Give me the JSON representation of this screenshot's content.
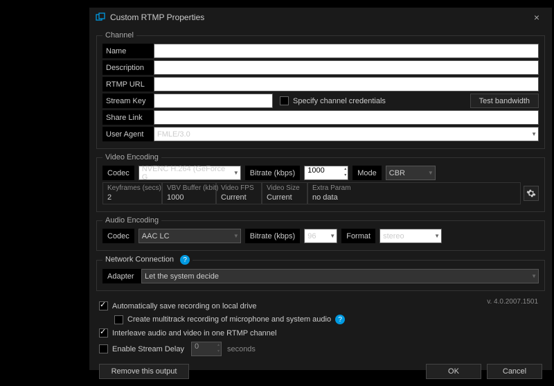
{
  "titlebar": {
    "title": "Custom RTMP Properties"
  },
  "channel": {
    "legend": "Channel",
    "name_label": "Name",
    "name_value": "",
    "desc_label": "Description",
    "desc_value": "",
    "url_label": "RTMP URL",
    "url_value": "",
    "key_label": "Stream Key",
    "key_value": "",
    "specify_label": "Specify channel credentials",
    "test_label": "Test bandwidth",
    "share_label": "Share Link",
    "share_value": "",
    "ua_label": "User Agent",
    "ua_value": "FMLE/3.0"
  },
  "video": {
    "legend": "Video Encoding",
    "codec_label": "Codec",
    "codec_value": "NVENC H.264 (GeForce G",
    "bitrate_label": "Bitrate (kbps)",
    "bitrate_value": "1000",
    "mode_label": "Mode",
    "mode_value": "CBR",
    "kf_label": "Keyframes (secs)",
    "kf_value": "2",
    "vbv_label": "VBV Buffer (kbit)",
    "vbv_value": "1000",
    "fps_label": "Video FPS",
    "fps_value": "Current",
    "size_label": "Video Size",
    "size_value": "Current",
    "extra_label": "Extra Param",
    "extra_value": "no data"
  },
  "audio": {
    "legend": "Audio Encoding",
    "codec_label": "Codec",
    "codec_value": "AAC LC",
    "bitrate_label": "Bitrate (kbps)",
    "bitrate_value": "96",
    "format_label": "Format",
    "format_value": "stereo"
  },
  "network": {
    "legend": "Network Connection",
    "adapter_label": "Adapter",
    "adapter_value": "Let the system decide"
  },
  "options": {
    "auto_save": "Automatically save recording on local drive",
    "multitrack": "Create multitrack recording of microphone and system audio",
    "interleave": "Interleave audio and video in one RTMP channel",
    "delay_label": "Enable Stream Delay",
    "delay_value": "0",
    "delay_unit": "seconds"
  },
  "footer": {
    "remove": "Remove this output",
    "ok": "OK",
    "cancel": "Cancel",
    "version": "v. 4.0.2007.1501"
  }
}
